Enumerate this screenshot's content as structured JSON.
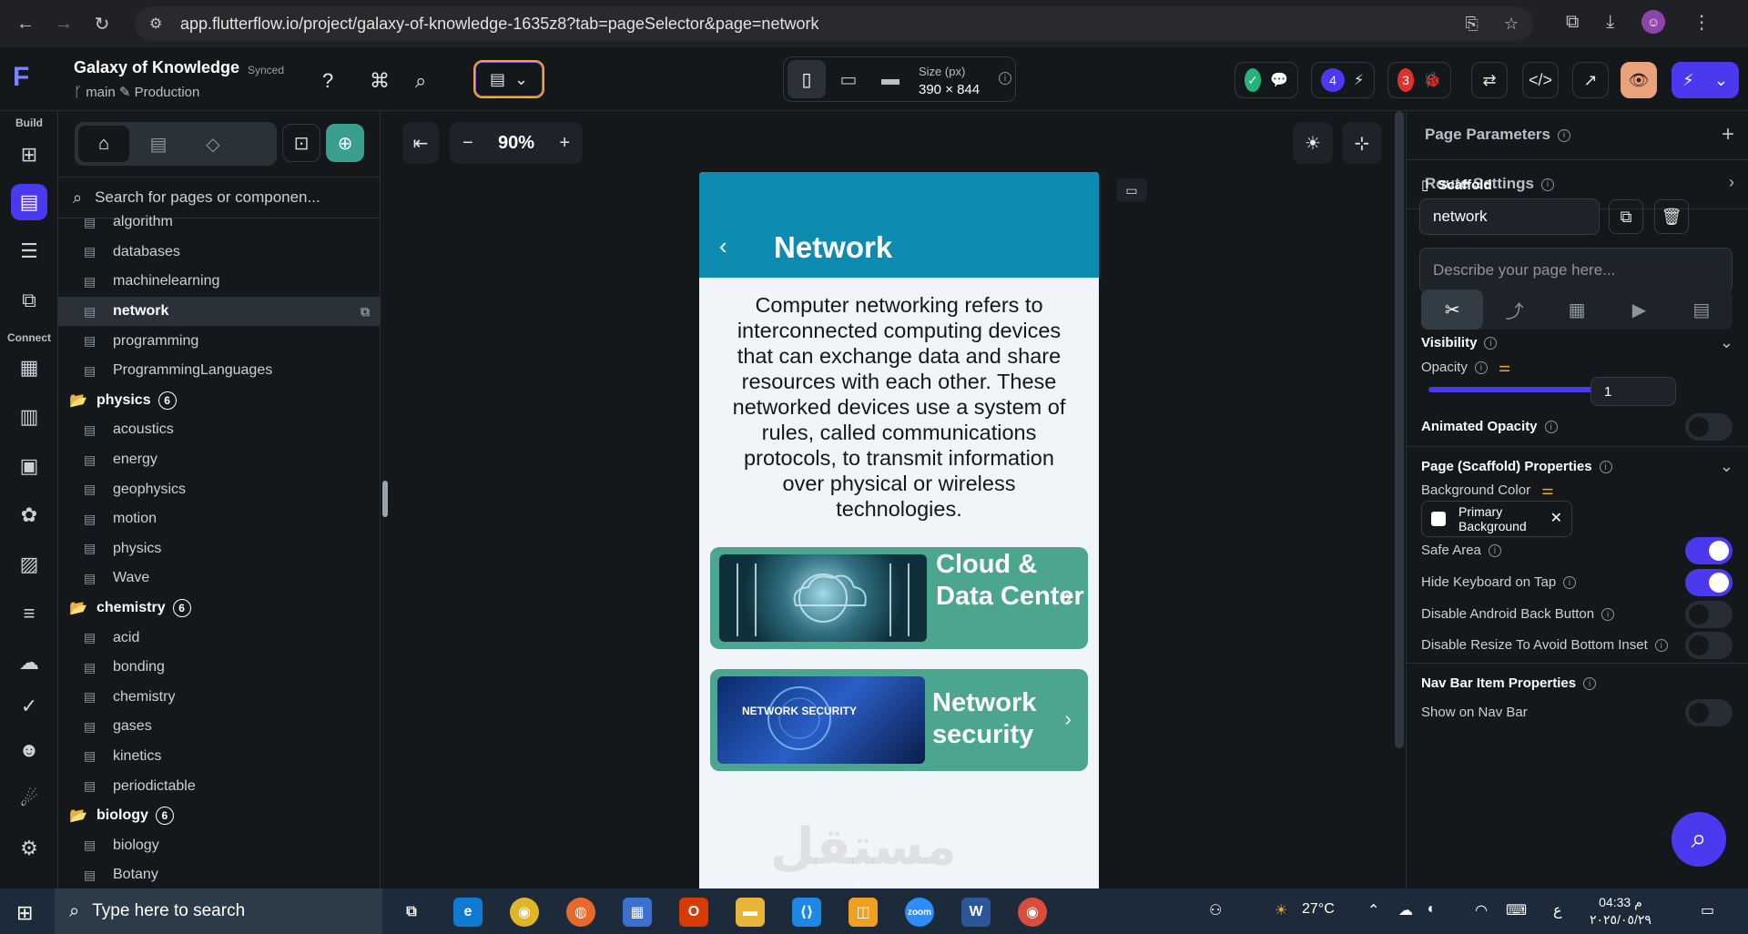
{
  "browser": {
    "url": "app.flutterflow.io/project/galaxy-of-knowledge-1635z8?tab=pageSelector&page=network"
  },
  "header": {
    "project_title": "Galaxy of Knowledge",
    "sync_status": "Synced",
    "branch": "main",
    "environment": "Production",
    "size_label": "Size (px)",
    "size_value": "390 × 844",
    "notifications_count": "4",
    "issues_count": "3"
  },
  "rail": {
    "build_label": "Build",
    "connect_label": "Connect"
  },
  "pages_panel": {
    "search_placeholder": "Search for pages or componen...",
    "items": [
      {
        "type": "page",
        "label": "algorithm"
      },
      {
        "type": "page",
        "label": "databases"
      },
      {
        "type": "page",
        "label": "machinelearning"
      },
      {
        "type": "page",
        "label": "network",
        "selected": true
      },
      {
        "type": "page",
        "label": "programming"
      },
      {
        "type": "page",
        "label": "ProgrammingLanguages"
      },
      {
        "type": "folder",
        "label": "physics",
        "count": "6"
      },
      {
        "type": "page",
        "label": "acoustics"
      },
      {
        "type": "page",
        "label": "energy"
      },
      {
        "type": "page",
        "label": "geophysics"
      },
      {
        "type": "page",
        "label": "motion"
      },
      {
        "type": "page",
        "label": "physics"
      },
      {
        "type": "page",
        "label": "Wave"
      },
      {
        "type": "folder",
        "label": "chemistry",
        "count": "6"
      },
      {
        "type": "page",
        "label": "acid"
      },
      {
        "type": "page",
        "label": "bonding"
      },
      {
        "type": "page",
        "label": "chemistry"
      },
      {
        "type": "page",
        "label": "gases"
      },
      {
        "type": "page",
        "label": "kinetics"
      },
      {
        "type": "page",
        "label": "periodictable"
      },
      {
        "type": "folder",
        "label": "biology",
        "count": "6"
      },
      {
        "type": "page",
        "label": "biology"
      },
      {
        "type": "page",
        "label": "Botany"
      }
    ]
  },
  "canvas": {
    "zoom": "90%",
    "phone": {
      "title": "Network",
      "description": "Computer networking refers to interconnected computing devices that can exchange data  and share resources with each other. These networked devices use a system of rules, called communications protocols, to transmit information over physical or wireless technologies.",
      "cards": [
        {
          "title": "Cloud & Data Center",
          "image_text": ""
        },
        {
          "title": "Network security",
          "image_text": "NETWORK SECURITY"
        }
      ],
      "watermark": "مستقل"
    },
    "watermark_url": "mostaql.com"
  },
  "properties": {
    "page_parameters": "Page Parameters",
    "route_settings": "Route Settings",
    "scaffold_label": "Scaffold",
    "page_name": "network",
    "description_placeholder": "Describe your page here...",
    "visibility": "Visibility",
    "opacity_label": "Opacity",
    "opacity_value": "1",
    "opacity_level": 1,
    "animated_opacity": "Animated Opacity",
    "scaffold_props": "Page (Scaffold) Properties",
    "bg_color_label": "Background Color",
    "bg_color_value": "Primary Background",
    "safe_area": "Safe Area",
    "hide_keyboard": "Hide Keyboard on Tap",
    "disable_back": "Disable Android Back Button",
    "disable_resize": "Disable Resize To Avoid Bottom Inset",
    "nav_bar_props": "Nav Bar Item Properties",
    "show_on_nav_bar": "Show on Nav Bar"
  },
  "taskbar": {
    "search_placeholder": "Type here to search",
    "temperature": "27°C",
    "time": "04:33 م",
    "date": "٢٠٢٥/٠٥/٢٩",
    "lang": "ع"
  },
  "colors": {
    "accent": "#4b39ef",
    "appbar": "#0e8bb0",
    "card": "#4ca58f"
  }
}
